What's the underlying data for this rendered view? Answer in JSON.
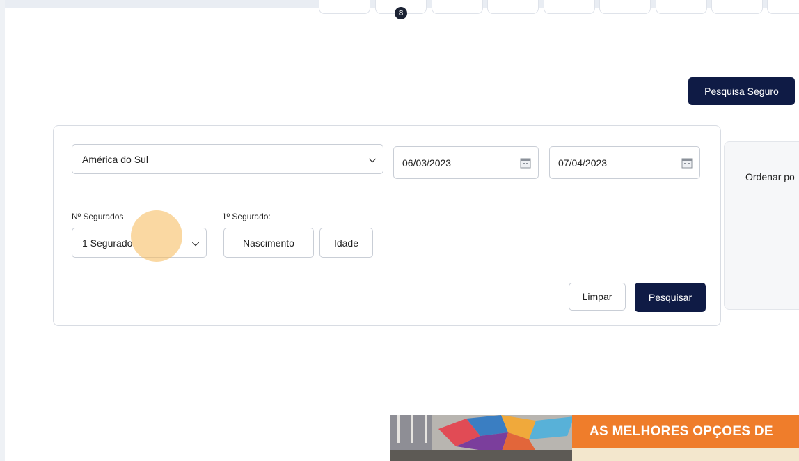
{
  "top_tabs": {
    "badge": "8"
  },
  "header": {
    "search_insurance_label": "Pesquisa Seguro"
  },
  "form": {
    "destination": "América do Sul",
    "start_date": "06/03/2023",
    "end_date": "07/04/2023",
    "insured_count_label": "Nº Segurados",
    "insured_count_value": "1 Segurado",
    "first_insured_label": "1º Segurado:",
    "birth_placeholder": "Nascimento",
    "age_placeholder": "Idade",
    "clear_label": "Limpar",
    "search_label": "Pesquisar"
  },
  "sort_panel": {
    "label": "Ordenar po"
  },
  "banner": {
    "title": "AS MELHORES OPÇOES DE"
  },
  "colors": {
    "primary": "#0f1b45",
    "banner_orange": "#ef7d2b"
  }
}
